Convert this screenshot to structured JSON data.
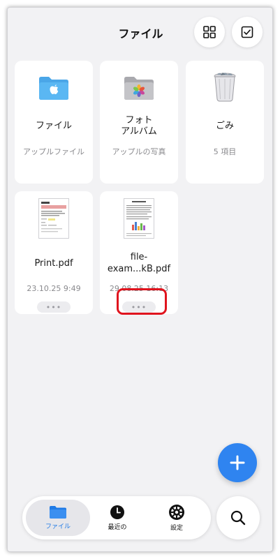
{
  "header": {
    "title": "ファイル",
    "grid_icon": "grid-view-icon",
    "select_icon": "checkbox-select-icon"
  },
  "items": [
    {
      "name": "ファイル",
      "subtitle": "アップルファイル",
      "icon": "apple-folder-icon"
    },
    {
      "name_line1": "フォト",
      "name_line2": "アルバム",
      "subtitle": "アップルの写真",
      "icon": "photos-folder-icon"
    },
    {
      "name": "ごみ",
      "subtitle": "5 項目",
      "icon": "trash-icon"
    },
    {
      "name": "Print.pdf",
      "date": "23.10.25 9:49",
      "more": "•••",
      "icon": "pdf-thumbnail-icon"
    },
    {
      "name_line1": "file-",
      "name_line2": "exam...kB.pdf",
      "date": "29.08.25 16:13",
      "more": "•••",
      "icon": "pdf-thumbnail-icon"
    }
  ],
  "tabs": [
    {
      "label": "ファイル",
      "icon": "folder-icon",
      "active": true
    },
    {
      "label": "最近の",
      "icon": "clock-icon",
      "active": false
    },
    {
      "label": "設定",
      "icon": "gear-icon",
      "active": false
    }
  ],
  "fab": {
    "icon": "plus-icon"
  },
  "search": {
    "icon": "search-icon"
  },
  "colors": {
    "accent": "#2f84f0",
    "folder_blue": "#5ab7f3",
    "highlight": "#e0141e",
    "background": "#f2f2f4"
  }
}
